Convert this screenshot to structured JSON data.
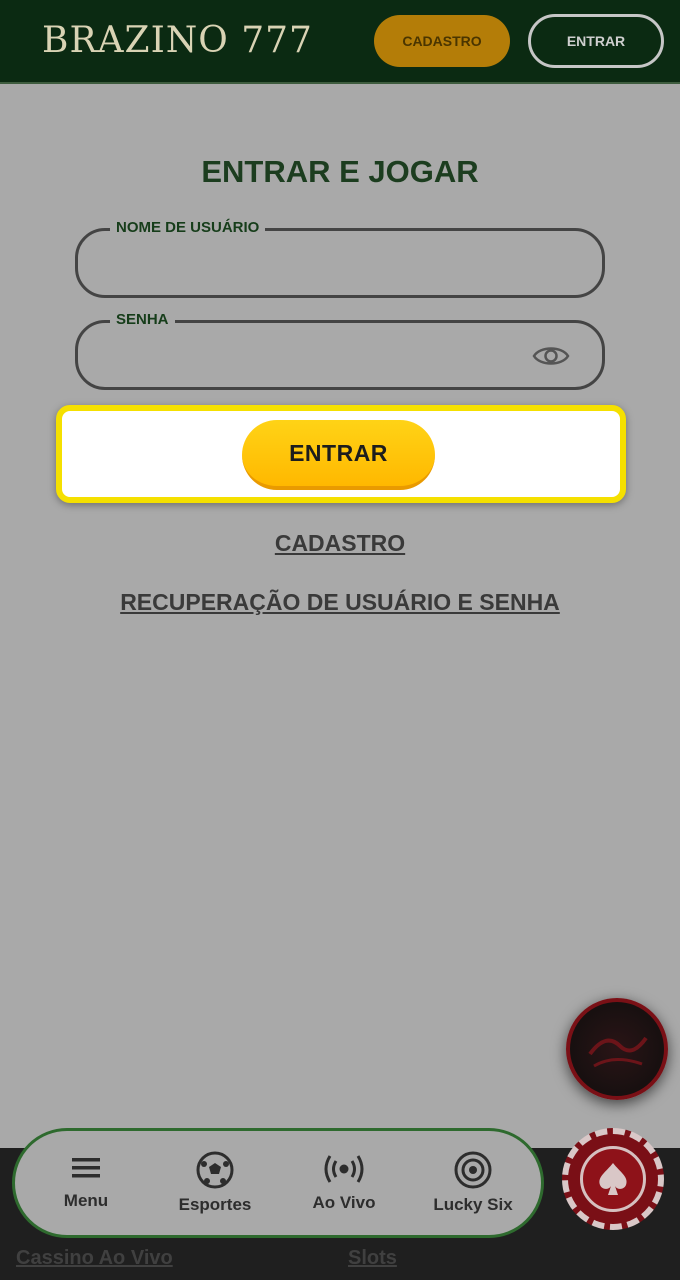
{
  "header": {
    "logo": "BRAZINO 777",
    "cadastro_label": "CADASTRO",
    "entrar_label": "ENTRAR"
  },
  "form": {
    "title": "ENTRAR E JOGAR",
    "username_label": "NOME DE USUÁRIO",
    "username_value": "",
    "password_label": "SENHA",
    "password_value": "",
    "password_toggle_icon": "eye-icon",
    "submit_label": "ENTRAR",
    "cadastro_link": "CADASTRO",
    "recovery_link": "RECUPERAÇÃO DE USUÁRIO E SENHA"
  },
  "bottom_nav": {
    "items": [
      {
        "label": "Menu",
        "icon": "menu-icon"
      },
      {
        "label": "Esportes",
        "icon": "soccer-ball-icon"
      },
      {
        "label": "Ao Vivo",
        "icon": "live-broadcast-icon"
      },
      {
        "label": "Lucky Six",
        "icon": "target-icon"
      }
    ]
  },
  "footer_links": [
    "Cassino Ao Vivo",
    "Slots"
  ],
  "colors": {
    "header_bg": "#0b2a12",
    "accent_yellow": "#ffc400",
    "highlight": "#f5e000",
    "chip_red": "#7a0f16"
  }
}
